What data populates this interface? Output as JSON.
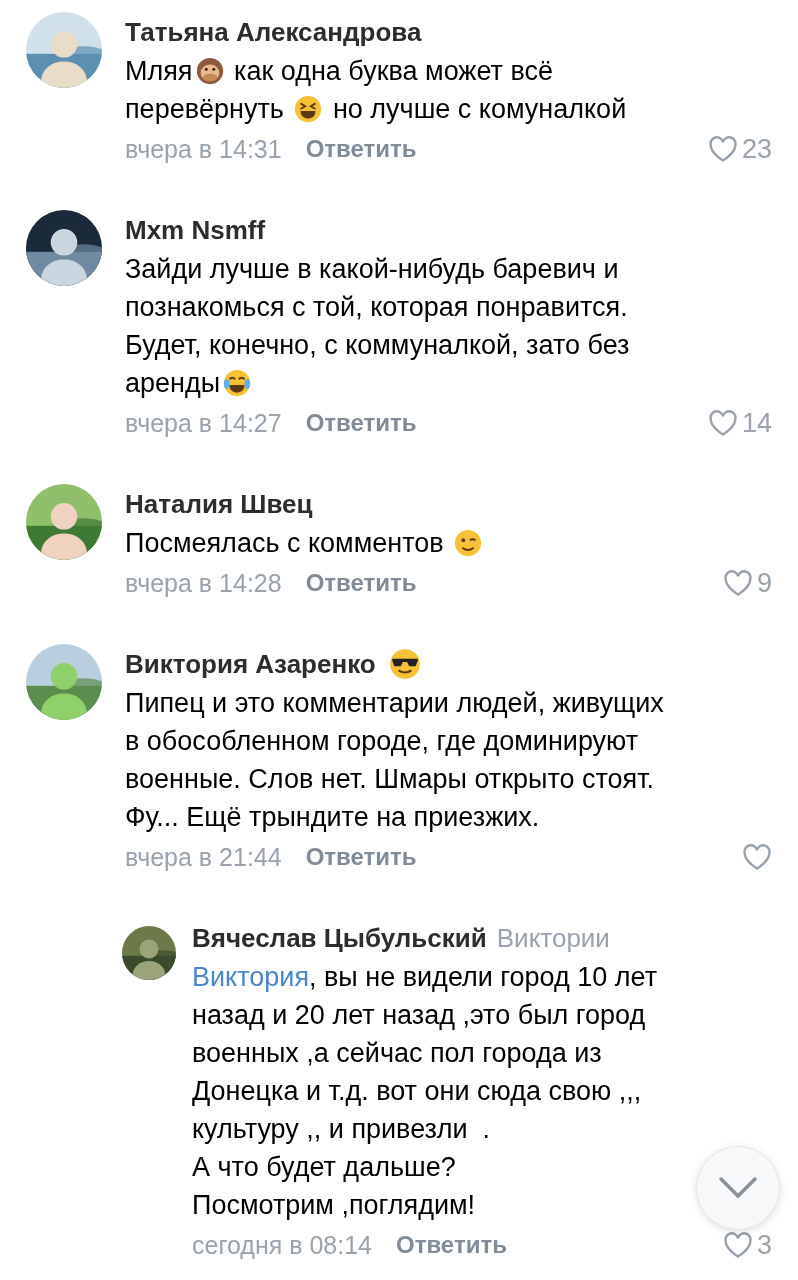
{
  "comments": [
    {
      "author": "Татьяна Александрова",
      "lines": [
        [
          {
            "kind": "text",
            "text": "Мляя"
          },
          {
            "kind": "monkey"
          },
          {
            "kind": "text",
            "text": " как одна буква может всё"
          }
        ],
        [
          {
            "kind": "text",
            "text": "перевёрнуть "
          },
          {
            "kind": "grin"
          },
          {
            "kind": "text",
            "text": " но лучше с комуналкой"
          }
        ]
      ],
      "time": "вчера в 14:31",
      "reply_label": "Ответить",
      "likes": "23"
    },
    {
      "author": "Mxm Nsmff",
      "lines": [
        [
          {
            "kind": "text",
            "text": "Зайди лучше в какой-нибудь баревич и"
          }
        ],
        [
          {
            "kind": "text",
            "text": "познакомься с той, которая понравится."
          }
        ],
        [
          {
            "kind": "text",
            "text": "Будет, конечно, с коммуналкой, зато без"
          }
        ],
        [
          {
            "kind": "text",
            "text": "аренды"
          },
          {
            "kind": "tears"
          }
        ]
      ],
      "time": "вчера в 14:27",
      "reply_label": "Ответить",
      "likes": "14"
    },
    {
      "author": "Наталия Швец",
      "lines": [
        [
          {
            "kind": "text",
            "text": "Посмеялась с комментов "
          },
          {
            "kind": "wink"
          }
        ]
      ],
      "time": "вчера в 14:28",
      "reply_label": "Ответить",
      "likes": "9"
    },
    {
      "author": "Виктория Азаренко",
      "name_badge": {
        "kind": "sunglasses"
      },
      "lines": [
        [
          {
            "kind": "text",
            "text": "Пипец и это комментарии людей, живущих"
          }
        ],
        [
          {
            "kind": "text",
            "text": "в обособленном городе, где доминируют"
          }
        ],
        [
          {
            "kind": "text",
            "text": "военные. Слов нет. Шмары открыто стоят."
          }
        ],
        [
          {
            "kind": "text",
            "text": "Фу... Ещё трындите на приезжих."
          }
        ]
      ],
      "time": "вчера в 21:44",
      "reply_label": "Ответить",
      "children": [
        {
          "author": "Вячеслав Цыбульский",
          "reply_to": "Виктории",
          "lines": [
            [
              {
                "kind": "link",
                "text": "Виктория"
              },
              {
                "kind": "text",
                "text": ", вы не видели город 10 лет"
              }
            ],
            [
              {
                "kind": "text",
                "text": "назад и 20 лет назад ,это был город"
              }
            ],
            [
              {
                "kind": "text",
                "text": "военных ,а сейчас пол города из"
              }
            ],
            [
              {
                "kind": "text",
                "text": "Донецка и т.д. вот они сюда свою ,,,"
              }
            ],
            [
              {
                "kind": "text",
                "text": "культуру ,, и привезли  ."
              }
            ],
            [
              {
                "kind": "text",
                "text": "А что будет дальше?"
              }
            ],
            [
              {
                "kind": "text",
                "text": "Посмотрим ,поглядим!"
              }
            ]
          ],
          "time": "сегодня в 08:14",
          "reply_label": "Ответить",
          "likes": "3"
        }
      ]
    }
  ]
}
